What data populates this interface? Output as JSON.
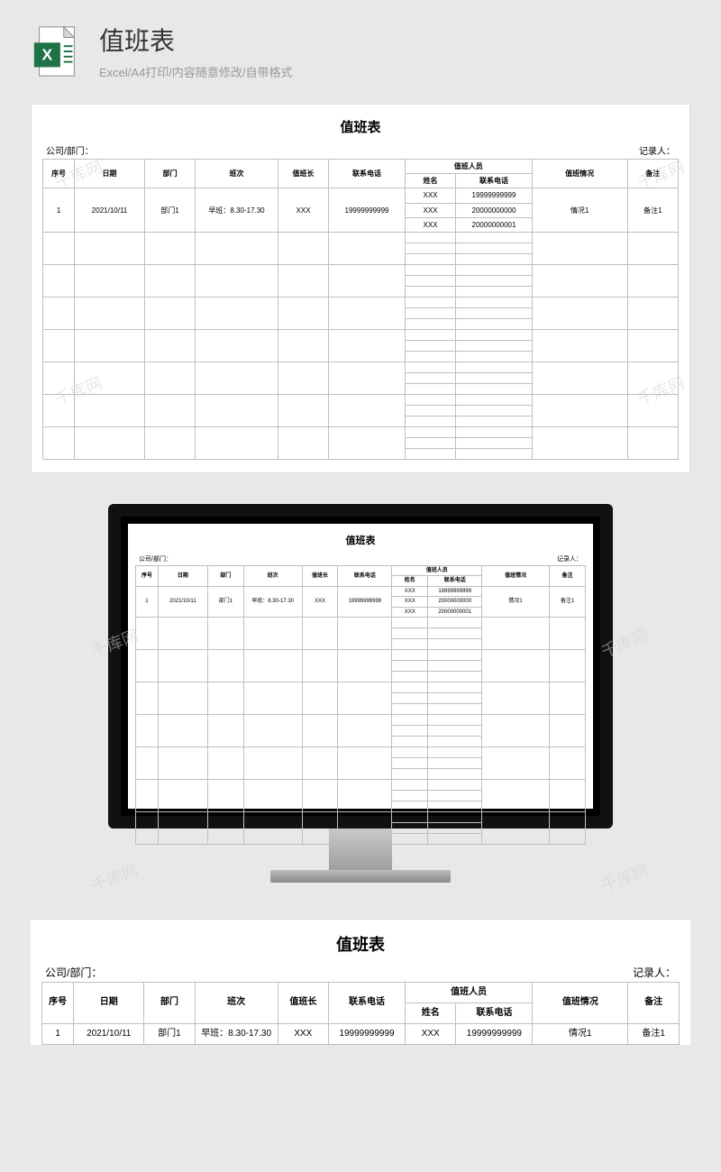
{
  "header": {
    "title": "值班表",
    "subtitle": "Excel/A4打印/内容随意修改/自带格式"
  },
  "doc": {
    "title": "值班表",
    "meta_left": "公司/部门：",
    "meta_right": "记录人：",
    "columns": {
      "seq": "序号",
      "date": "日期",
      "dept": "部门",
      "shift": "班次",
      "leader": "值班长",
      "phone": "联系电话",
      "staff_group": "值班人员",
      "staff_name": "姓名",
      "staff_phone": "联系电话",
      "situation": "值班情况",
      "remark": "备注"
    },
    "row": {
      "seq": "1",
      "date": "2021/10/11",
      "dept": "部门1",
      "shift": "早班：8.30-17.30",
      "leader": "XXX",
      "phone": "19999999999",
      "staff": [
        {
          "name": "XXX",
          "phone": "19999999999"
        },
        {
          "name": "XXX",
          "phone": "20000000000"
        },
        {
          "name": "XXX",
          "phone": "20000000001"
        }
      ],
      "situation": "情况1",
      "remark": "备注1"
    }
  },
  "watermark": "千库网"
}
